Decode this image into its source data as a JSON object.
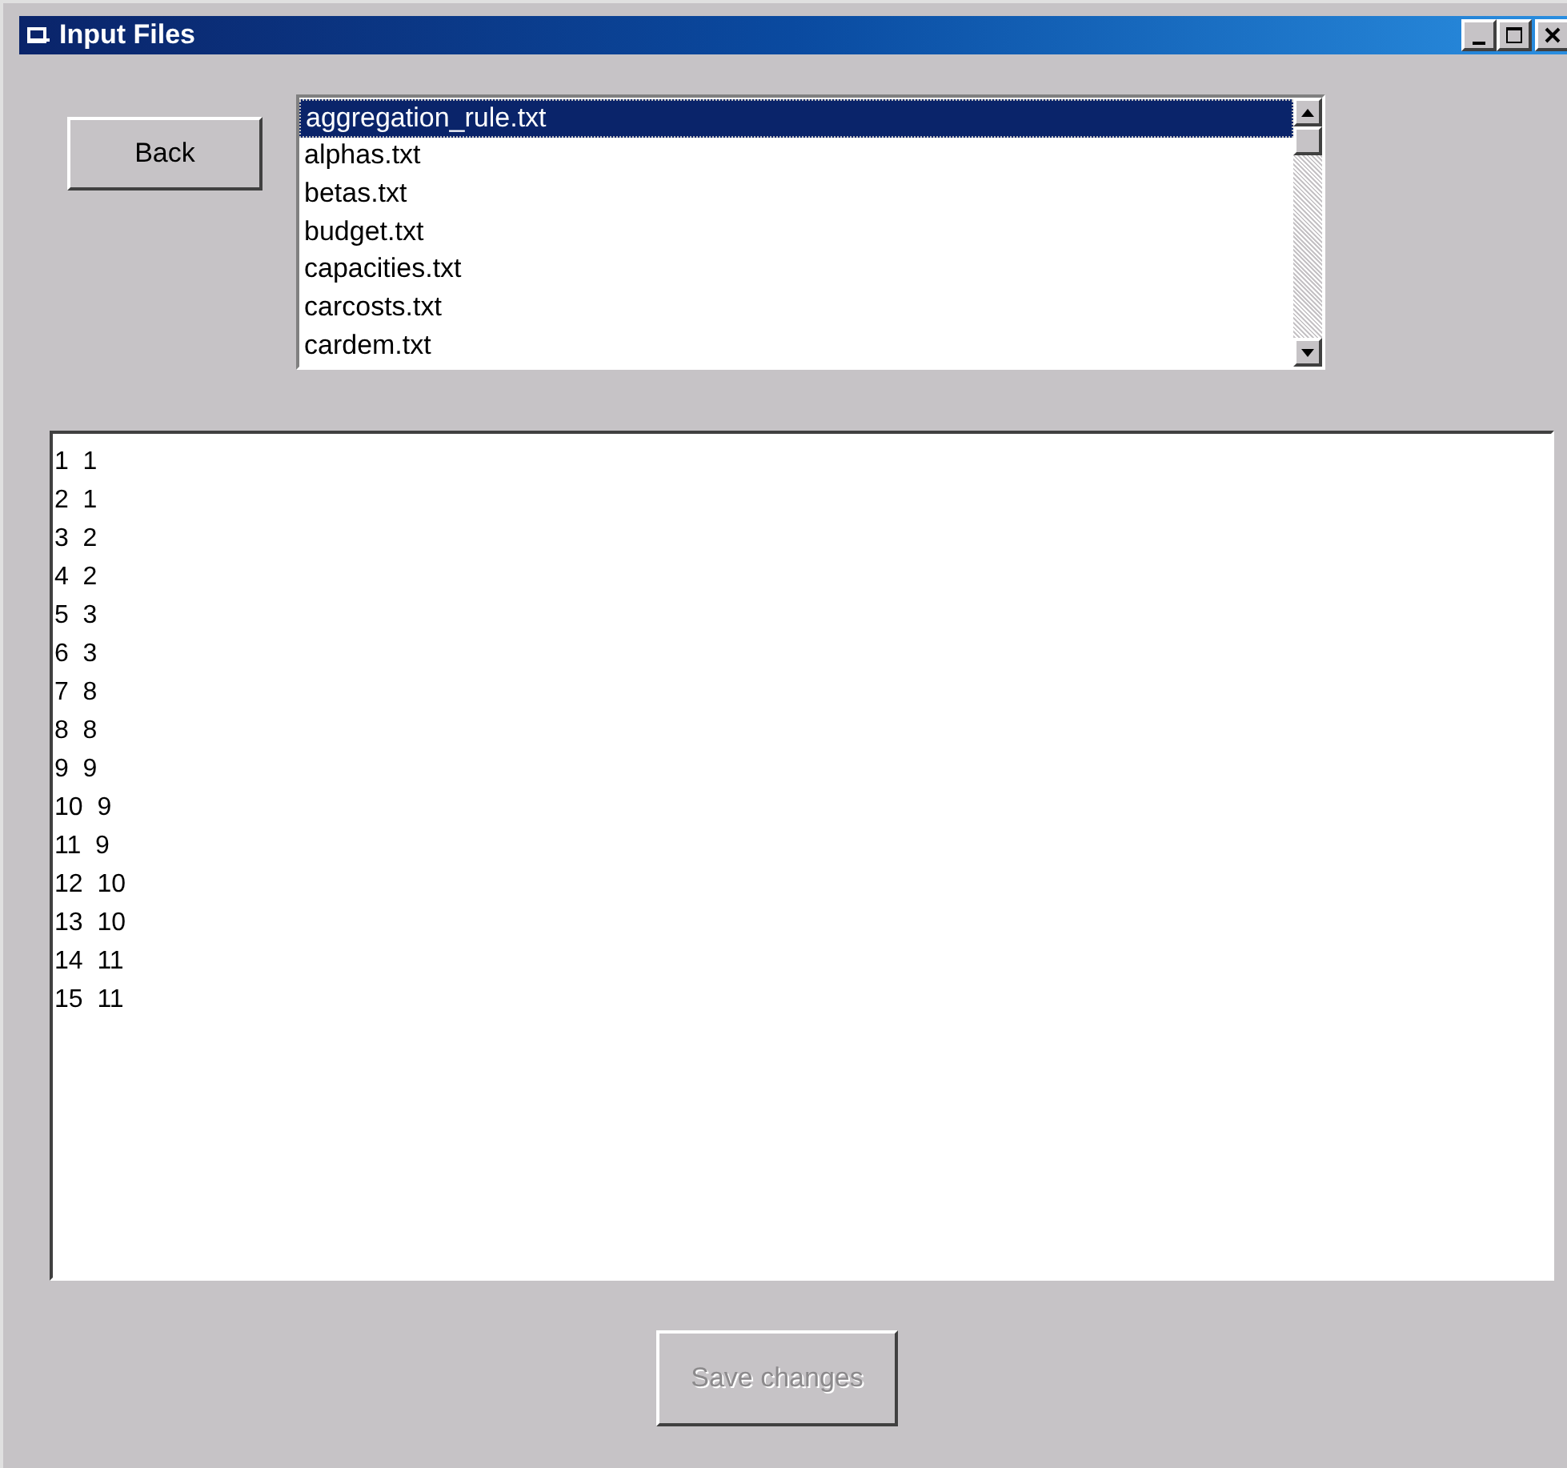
{
  "window": {
    "title": "Input Files"
  },
  "back_button": {
    "label": "Back"
  },
  "file_list": {
    "items": [
      {
        "label": "aggregation_rule.txt",
        "selected": true
      },
      {
        "label": "alphas.txt",
        "selected": false
      },
      {
        "label": "betas.txt",
        "selected": false
      },
      {
        "label": "budget.txt",
        "selected": false
      },
      {
        "label": "capacities.txt",
        "selected": false
      },
      {
        "label": "carcosts.txt",
        "selected": false
      },
      {
        "label": "cardem.txt",
        "selected": false
      }
    ]
  },
  "editor": {
    "lines": [
      [
        "1",
        "1"
      ],
      [
        "2",
        "1"
      ],
      [
        "3",
        "2"
      ],
      [
        "4",
        "2"
      ],
      [
        "5",
        "3"
      ],
      [
        "6",
        "3"
      ],
      [
        "7",
        "8"
      ],
      [
        "8",
        "8"
      ],
      [
        "9",
        "9"
      ],
      [
        "10",
        "9"
      ],
      [
        "11",
        "9"
      ],
      [
        "12",
        "10"
      ],
      [
        "13",
        "10"
      ],
      [
        "14",
        "11"
      ],
      [
        "15",
        "11"
      ]
    ]
  },
  "save_button": {
    "label": "Save changes",
    "disabled": true
  }
}
